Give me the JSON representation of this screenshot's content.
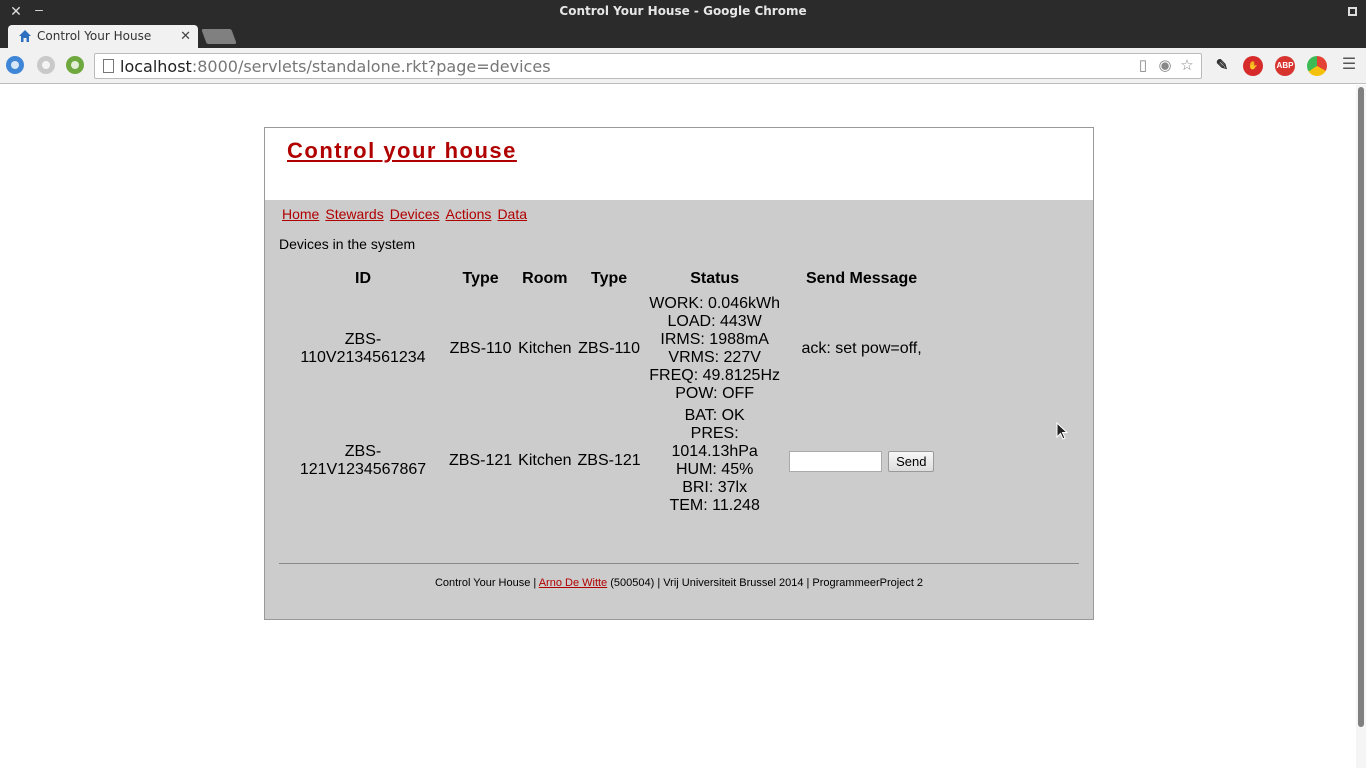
{
  "window": {
    "title": "Control Your House - Google Chrome"
  },
  "tabs": [
    {
      "label": "Control Your House",
      "active": true
    }
  ],
  "address_bar": {
    "host": "localhost",
    "path": ":8000/servlets/standalone.rkt?page=devices"
  },
  "site": {
    "title": "Control your house",
    "nav": [
      "Home",
      "Stewards",
      "Devices",
      "Actions",
      "Data"
    ],
    "subtitle": "Devices in the system"
  },
  "table": {
    "headers": [
      "ID",
      "Type",
      "Room",
      "Type",
      "Status",
      "Send Message"
    ],
    "rows": [
      {
        "id": "ZBS-110V2134561234",
        "type": "ZBS-110",
        "room": "Kitchen",
        "type2": "ZBS-110",
        "status": [
          "WORK: 0.046kWh",
          "LOAD: 443W",
          "IRMS: 1988mA",
          "VRMS: 227V",
          "FREQ: 49.8125Hz",
          "POW: OFF"
        ],
        "message": "ack: set pow=off,"
      },
      {
        "id": "ZBS-121V1234567867",
        "type": "ZBS-121",
        "room": "Kitchen",
        "type2": "ZBS-121",
        "status": [
          "BAT: OK",
          "PRES: 1014.13hPa",
          "HUM: 45%",
          "BRI: 37lx",
          "TEM: 11.248"
        ],
        "input_value": "",
        "send_label": "Send"
      }
    ]
  },
  "footer": {
    "prefix": "Control Your House | ",
    "author": "Arno De Witte",
    "suffix": " (500504) | Vrij Universiteit Brussel 2014 | ProgrammeerProject 2"
  },
  "colors": {
    "accent_red": "#b00000",
    "page_bg": "#cccccc"
  }
}
